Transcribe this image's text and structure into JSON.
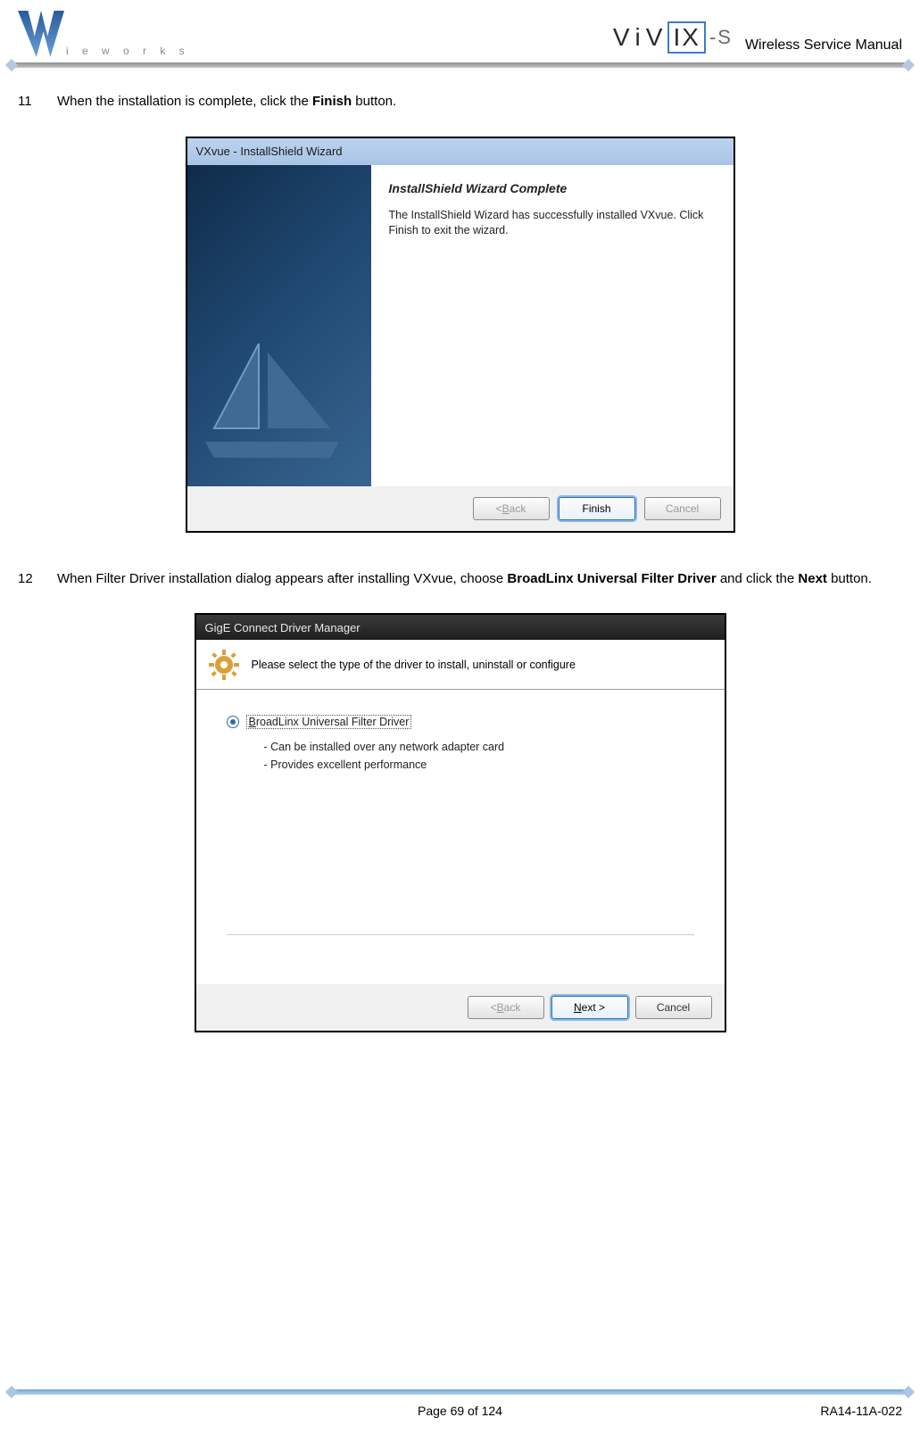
{
  "header": {
    "logo_text": "i e w o r k s",
    "product": {
      "v1": "V",
      "i1": "i",
      "v2": "V",
      "boxed": "IX",
      "suffix": "-S"
    },
    "manual_title": "Wireless Service Manual"
  },
  "steps": {
    "s11": {
      "num": "11",
      "pre": "When the installation is complete, click the ",
      "bold": "Finish",
      "post": " button."
    },
    "s12": {
      "num": "12",
      "pre": "When Filter Driver installation dialog appears after installing VXvue, choose ",
      "bold1": "BroadLinx Universal Filter Driver",
      "mid": " and click the ",
      "bold2": "Next",
      "post": " button."
    }
  },
  "dialog1": {
    "title": "VXvue - InstallShield Wizard",
    "heading": "InstallShield Wizard Complete",
    "body": "The InstallShield Wizard has successfully installed VXvue. Click Finish to exit the wizard.",
    "btn_back_prefix": "< ",
    "btn_back_u": "B",
    "btn_back_suffix": "ack",
    "btn_finish": "Finish",
    "btn_cancel": "Cancel"
  },
  "dialog2": {
    "title": "GigE Connect Driver Manager",
    "prompt": "Please select the type of the driver to install, uninstall or configure",
    "radio_u": "B",
    "radio_suffix": "roadLinx Universal Filter Driver",
    "note1": "- Can be installed over any network adapter card",
    "note2": "- Provides excellent performance",
    "btn_back_prefix": "< ",
    "btn_back_u": "B",
    "btn_back_suffix": "ack",
    "btn_next_u": "N",
    "btn_next_suffix": "ext >",
    "btn_cancel": "Cancel"
  },
  "footer": {
    "page": "Page 69 of 124",
    "doc": "RA14-11A-022"
  }
}
